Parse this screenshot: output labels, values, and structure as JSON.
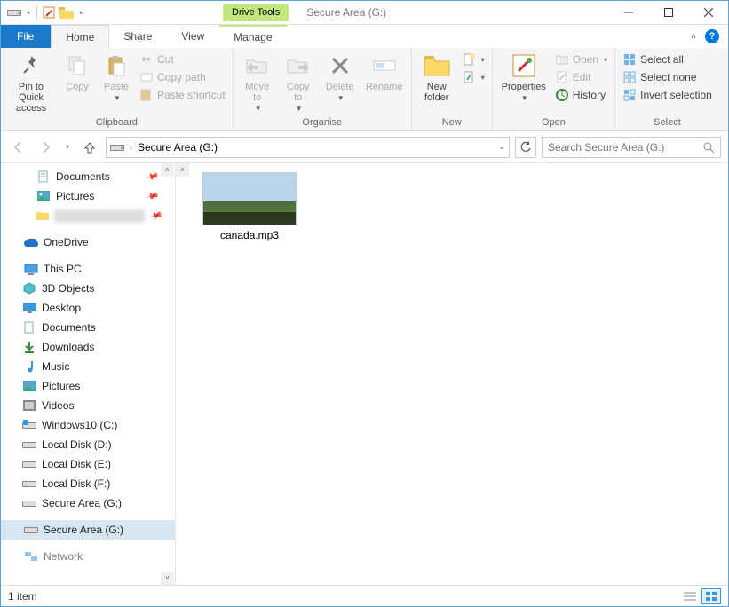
{
  "window": {
    "title": "Secure Area (G:)",
    "drive_tools_tab": "Drive Tools"
  },
  "tabs": {
    "file": "File",
    "home": "Home",
    "share": "Share",
    "view": "View",
    "manage": "Manage"
  },
  "ribbon": {
    "clipboard": {
      "label": "Clipboard",
      "pin": "Pin to Quick\naccess",
      "copy": "Copy",
      "paste": "Paste",
      "cut": "Cut",
      "copy_path": "Copy path",
      "paste_shortcut": "Paste shortcut"
    },
    "organise": {
      "label": "Organise",
      "move_to": "Move\nto",
      "copy_to": "Copy\nto",
      "delete": "Delete",
      "rename": "Rename"
    },
    "new": {
      "label": "New",
      "new_folder": "New\nfolder",
      "new_item": "New item",
      "easy_access": "Easy access"
    },
    "open": {
      "label": "Open",
      "properties": "Properties",
      "open": "Open",
      "edit": "Edit",
      "history": "History"
    },
    "select": {
      "label": "Select",
      "select_all": "Select all",
      "select_none": "Select none",
      "invert": "Invert selection"
    }
  },
  "nav": {
    "address": "Secure Area (G:)",
    "search_placeholder": "Search Secure Area (G:)"
  },
  "tree": {
    "documents": "Documents",
    "pictures": "Pictures",
    "blurred": "",
    "onedrive": "OneDrive",
    "thispc": "This PC",
    "pc": {
      "objects3d": "3D Objects",
      "desktop": "Desktop",
      "documents": "Documents",
      "downloads": "Downloads",
      "music": "Music",
      "pictures": "Pictures",
      "videos": "Videos",
      "windows_c": "Windows10 (C:)",
      "local_d": "Local Disk (D:)",
      "local_e": "Local Disk (E:)",
      "local_f": "Local Disk (F:)",
      "secure_g": "Secure Area (G:)"
    },
    "secure_g_root": "Secure Area (G:)",
    "network": "Network"
  },
  "files": [
    {
      "name": "canada.mp3"
    }
  ],
  "status": {
    "count": "1 item"
  }
}
